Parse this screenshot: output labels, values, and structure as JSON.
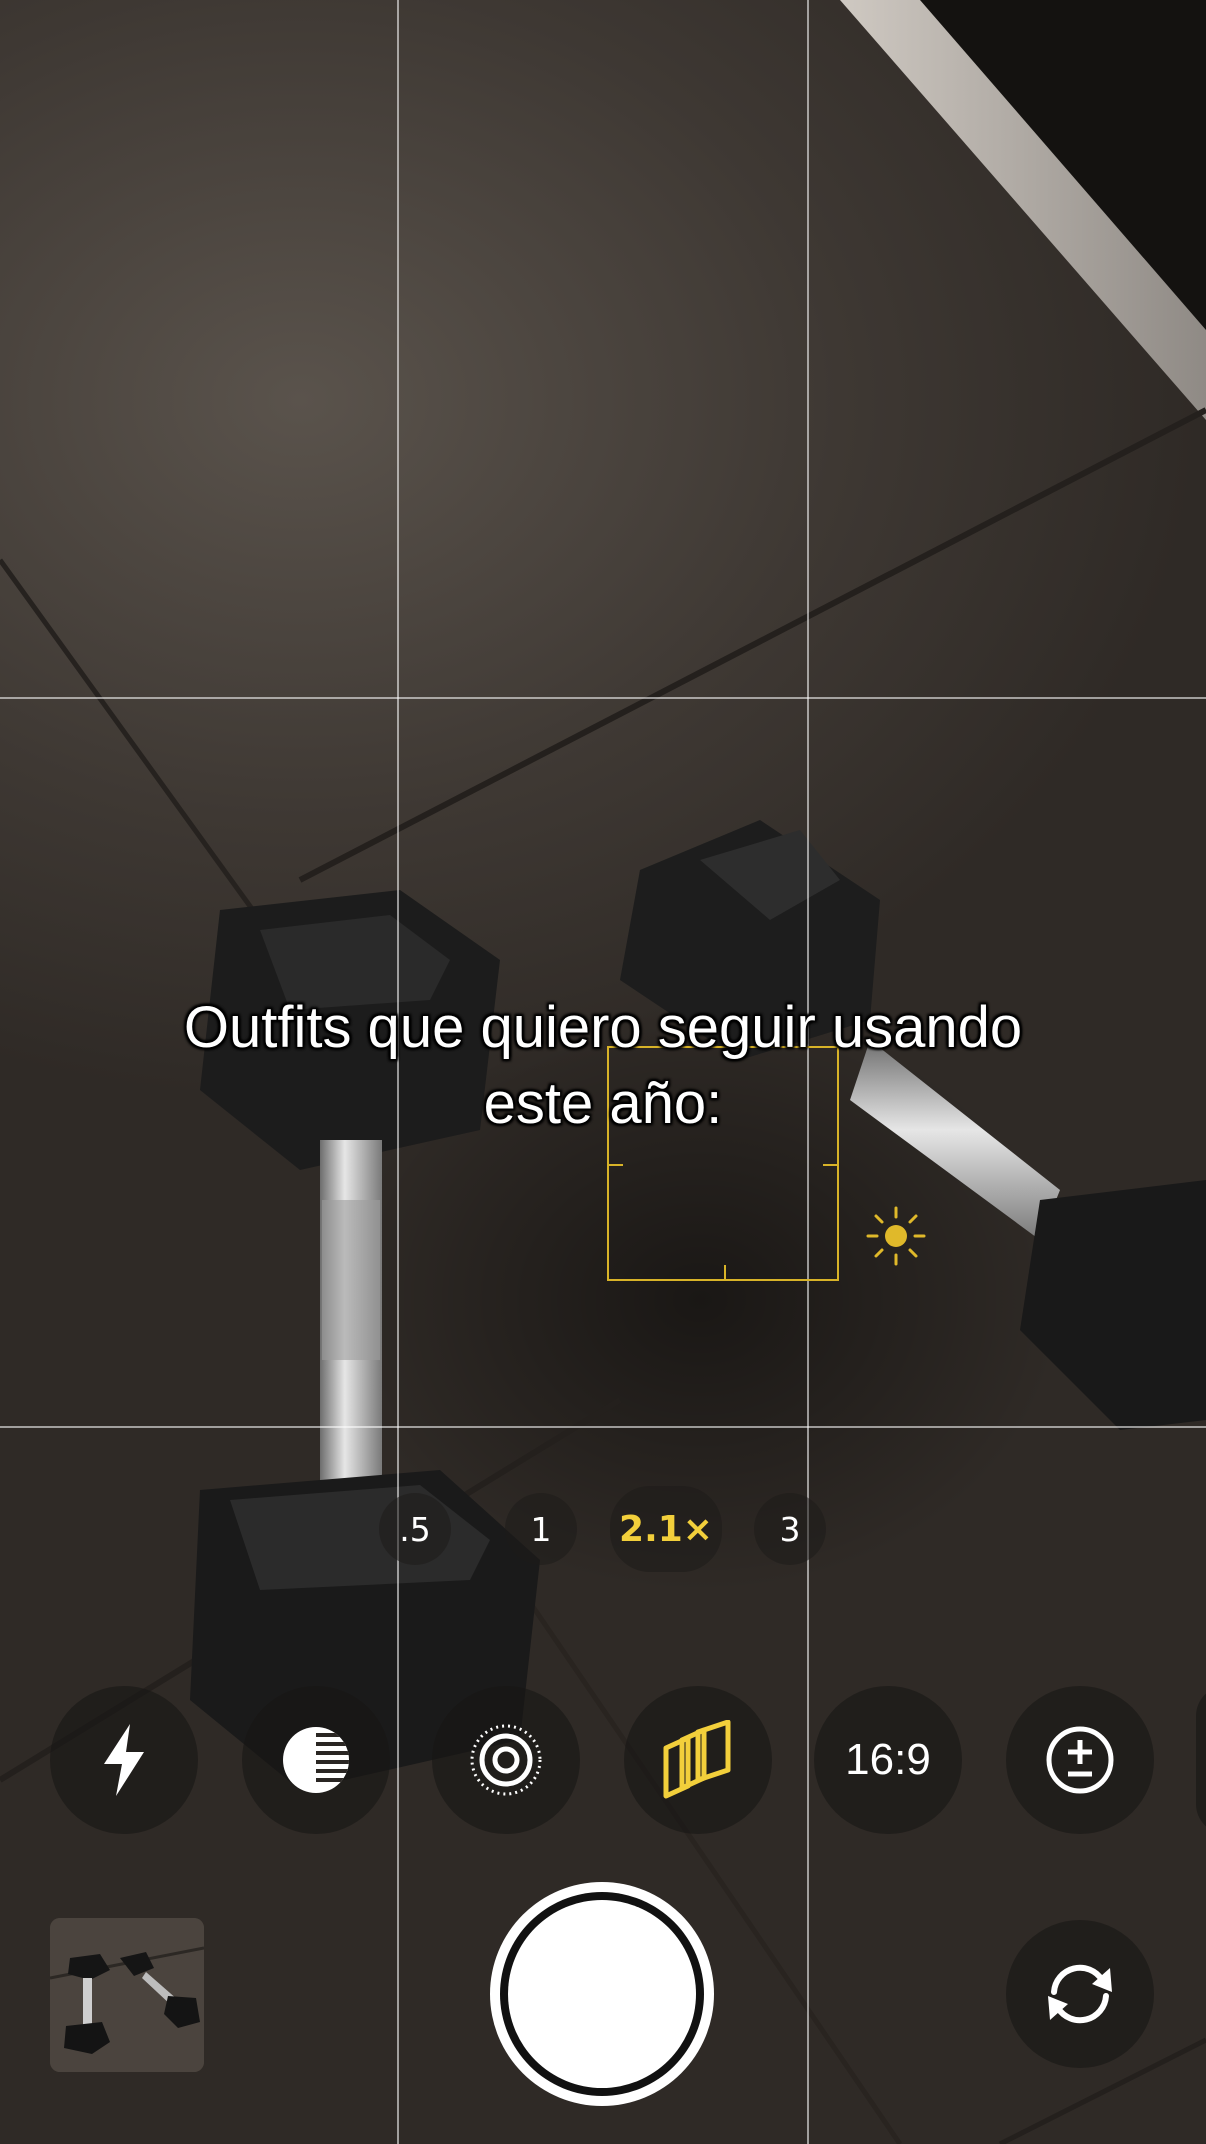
{
  "caption": {
    "line1": "Outfits que quiero seguir usando",
    "line2": "este año:"
  },
  "zoom": {
    "options": [
      ".5",
      "1",
      "2.1×",
      "3"
    ],
    "selected": "2.1×"
  },
  "controls": {
    "flash_icon": "flash-icon",
    "night_mode_icon": "night-mode-icon",
    "live_photo_icon": "live-photo-icon",
    "styles_icon": "photographic-styles-icon",
    "aspect_ratio_label": "16:9",
    "exposure_icon": "exposure-icon",
    "flip_icon": "flip-camera-icon"
  },
  "colors": {
    "accent": "#f2cf3b",
    "focus_box": "#d8b328",
    "shutter": "#ffffff"
  }
}
